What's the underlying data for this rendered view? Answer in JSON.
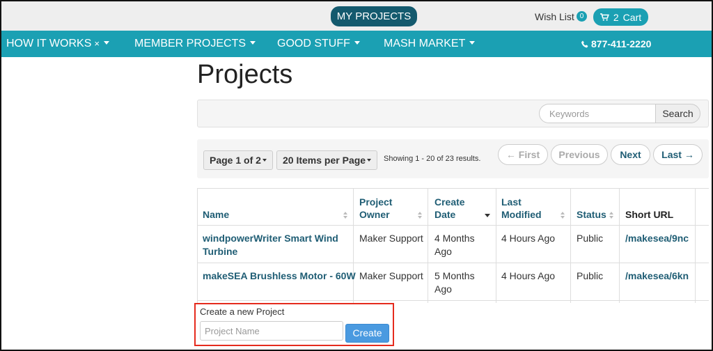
{
  "header": {
    "my_projects": "MY PROJECTS",
    "wish_list": "Wish List",
    "wish_count": "0",
    "cart_count": "2",
    "cart_label": "Cart"
  },
  "nav": {
    "items": [
      {
        "label": "HOW IT WORKS",
        "close": "×"
      },
      {
        "label": "MEMBER PROJECTS"
      },
      {
        "label": "GOOD STUFF"
      },
      {
        "label": "MASH MARKET"
      }
    ],
    "phone": "877-411-2220"
  },
  "page_title": "Projects",
  "search": {
    "placeholder": "Keywords",
    "value": "",
    "button": "Search"
  },
  "pagination": {
    "page_select": "Page 1 of 2",
    "per_page_select": "20 Items per Page",
    "showing": "Showing 1 - 20 of 23 results.",
    "first": "← First",
    "previous": "Previous",
    "next": "Next",
    "last": "Last →"
  },
  "table": {
    "headers": {
      "name": "Name",
      "owner_1": "Project",
      "owner_2": "Owner",
      "created_1": "Create",
      "created_2": "Date",
      "modified_1": "Last",
      "modified_2": "Modified",
      "status": "Status",
      "short_url": "Short URL"
    },
    "rows": [
      {
        "name_1": "windpowerWriter Smart Wind",
        "name_2": "Turbine",
        "owner": "Maker Support",
        "created_1": "4 Months",
        "created_2": "Ago",
        "modified": "4 Hours Ago",
        "status": "Public",
        "short_url": "/makesea/9nc"
      },
      {
        "name_1": "makeSEA Brushless Motor - 60W",
        "owner": "Maker Support",
        "created_1": "5 Months",
        "created_2": "Ago",
        "modified": "4 Hours Ago",
        "status": "Public",
        "short_url": "/makesea/6kn"
      }
    ]
  },
  "create_project": {
    "label": "Create a new Project",
    "placeholder": "Project Name",
    "value": "",
    "button": "Create"
  },
  "colors": {
    "nav": "#1ba0b3",
    "my_projects": "#145a6e",
    "link": "#1f5d74",
    "highlight_border": "#e52b1d",
    "create_button": "#4a9ae0"
  }
}
